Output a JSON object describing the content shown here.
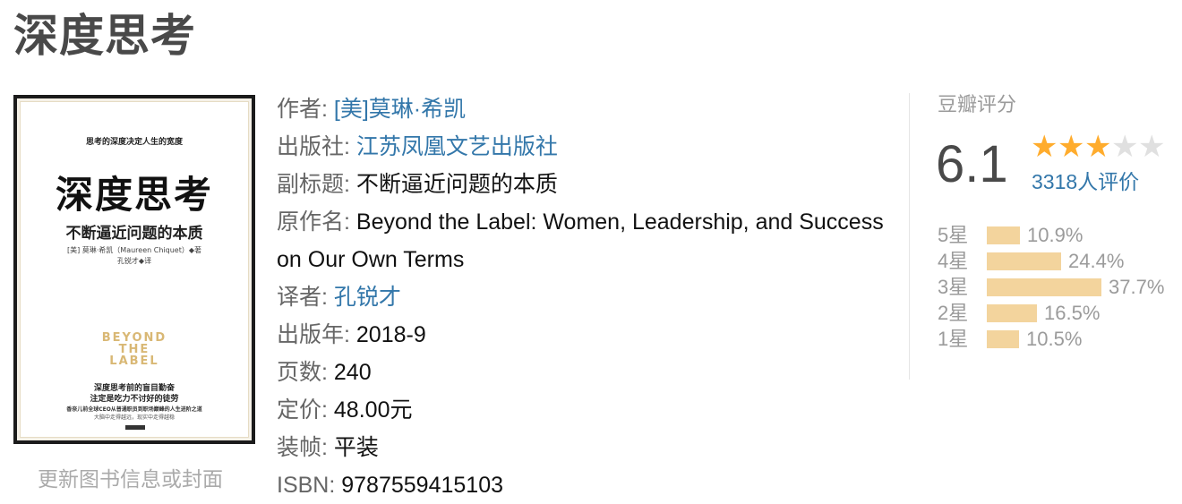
{
  "title": "深度思考",
  "cover": {
    "tagline": "思考的深度决定人生的宽度",
    "title": "深度思考",
    "subtitle": "不断逼近问题的本质",
    "author_line": "[美] 莫琳·希凯（Maureen Chiquet）◆著",
    "translator_line": "孔锐才◆译",
    "english_title": "BEYOND THE LABEL",
    "slogan_1": "深度思考前的盲目勤奋",
    "slogan_2": "注定是吃力不讨好的徒劳",
    "small_1": "香奈儿前全球CEO从普通职员到职场巅峰的人生进阶之道",
    "small_2": "大脑中走得越远，现实中走得越稳"
  },
  "update_link": "更新图书信息或封面",
  "info": {
    "author_label": "作者:",
    "author_value": "[美]莫琳·希凯",
    "publisher_label": "出版社:",
    "publisher_value": "江苏凤凰文艺出版社",
    "subtitle_label": "副标题:",
    "subtitle_value": "不断逼近问题的本质",
    "original_label": "原作名:",
    "original_value": "Beyond the Label: Women, Leadership, and Success on Our Own Terms",
    "translator_label": "译者:",
    "translator_value": "孔锐才",
    "year_label": "出版年:",
    "year_value": "2018-9",
    "pages_label": "页数:",
    "pages_value": "240",
    "price_label": "定价:",
    "price_value": "48.00元",
    "binding_label": "装帧:",
    "binding_value": "平装",
    "isbn_label": "ISBN:",
    "isbn_value": "9787559415103"
  },
  "rating": {
    "label": "豆瓣评分",
    "score": "6.1",
    "stars_filled": 3,
    "stars_total": 5,
    "votes": "3318人评价",
    "star_color": "#ffac2d",
    "bar_color": "#f2cf92",
    "distribution": [
      {
        "label": "5星",
        "percent": "10.9%",
        "value": 10.9
      },
      {
        "label": "4星",
        "percent": "24.4%",
        "value": 24.4
      },
      {
        "label": "3星",
        "percent": "37.7%",
        "value": 37.7
      },
      {
        "label": "2星",
        "percent": "16.5%",
        "value": 16.5
      },
      {
        "label": "1星",
        "percent": "10.5%",
        "value": 10.5
      }
    ]
  }
}
